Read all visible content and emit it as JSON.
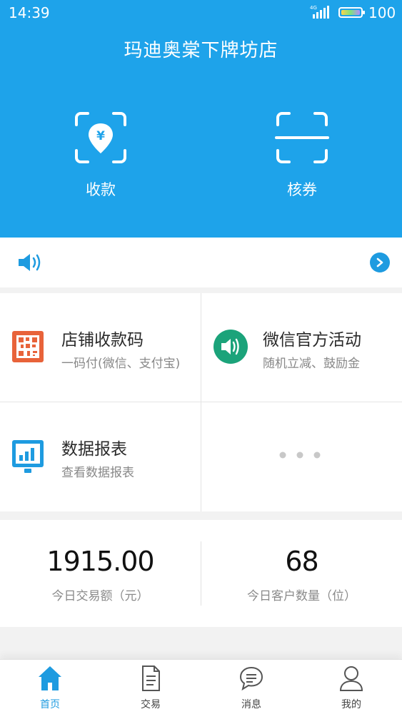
{
  "status_bar": {
    "time": "14:39",
    "network": "4G",
    "battery": "100"
  },
  "header": {
    "store_name": "玛迪奥棠下牌坊店"
  },
  "quick_actions": [
    {
      "label": "收款",
      "icon": "yuan-scan-icon"
    },
    {
      "label": "核券",
      "icon": "scan-frame-icon"
    }
  ],
  "notice": {
    "icon": "speaker-icon"
  },
  "features": [
    {
      "title": "店铺收款码",
      "subtitle": "一码付(微信、支付宝)",
      "icon": "qr-code-icon"
    },
    {
      "title": "微信官方活动",
      "subtitle": "随机立减、鼓励金",
      "icon": "speaker-circle-icon"
    },
    {
      "title": "数据报表",
      "subtitle": "查看数据报表",
      "icon": "report-chart-icon"
    }
  ],
  "stats": [
    {
      "value": "1915.00",
      "label": "今日交易额（元）"
    },
    {
      "value": "68",
      "label": "今日客户数量（位）"
    }
  ],
  "tabs": [
    {
      "label": "首页",
      "icon": "home-icon",
      "active": true
    },
    {
      "label": "交易",
      "icon": "document-icon",
      "active": false
    },
    {
      "label": "消息",
      "icon": "message-icon",
      "active": false
    },
    {
      "label": "我的",
      "icon": "user-icon",
      "active": false
    }
  ],
  "colors": {
    "primary": "#1ea3ea",
    "accent_orange": "#e8633a",
    "accent_green": "#1ba37a",
    "tab_active": "#1e9be0"
  }
}
